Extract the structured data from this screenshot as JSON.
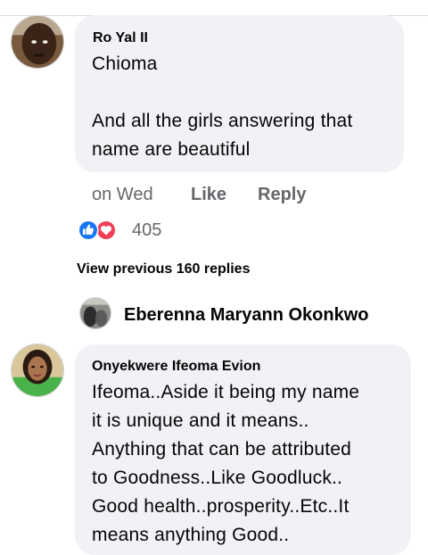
{
  "comment1": {
    "author": "Ro Yal II",
    "text": "Chioma\n\nAnd all the girls answering that\nname are beautiful",
    "time": "on Wed",
    "like_label": "Like",
    "reply_label": "Reply",
    "reaction_count": "405",
    "reaction_icons": [
      "like-icon",
      "love-icon"
    ],
    "colors": {
      "like": "#1877f2",
      "love": "#f33e58"
    }
  },
  "view_previous": "View previous 160 replies",
  "replier": {
    "name": "Eberenna Maryann Okonkwo"
  },
  "comment2": {
    "author": "Onyekwere Ifeoma Evion",
    "text": "Ifeoma..Aside it being my name\nit is unique and it means..\nAnything that can be attributed\nto Goodness..Like Goodluck..\nGood health..prosperity..Etc..It\nmeans anything Good.."
  }
}
